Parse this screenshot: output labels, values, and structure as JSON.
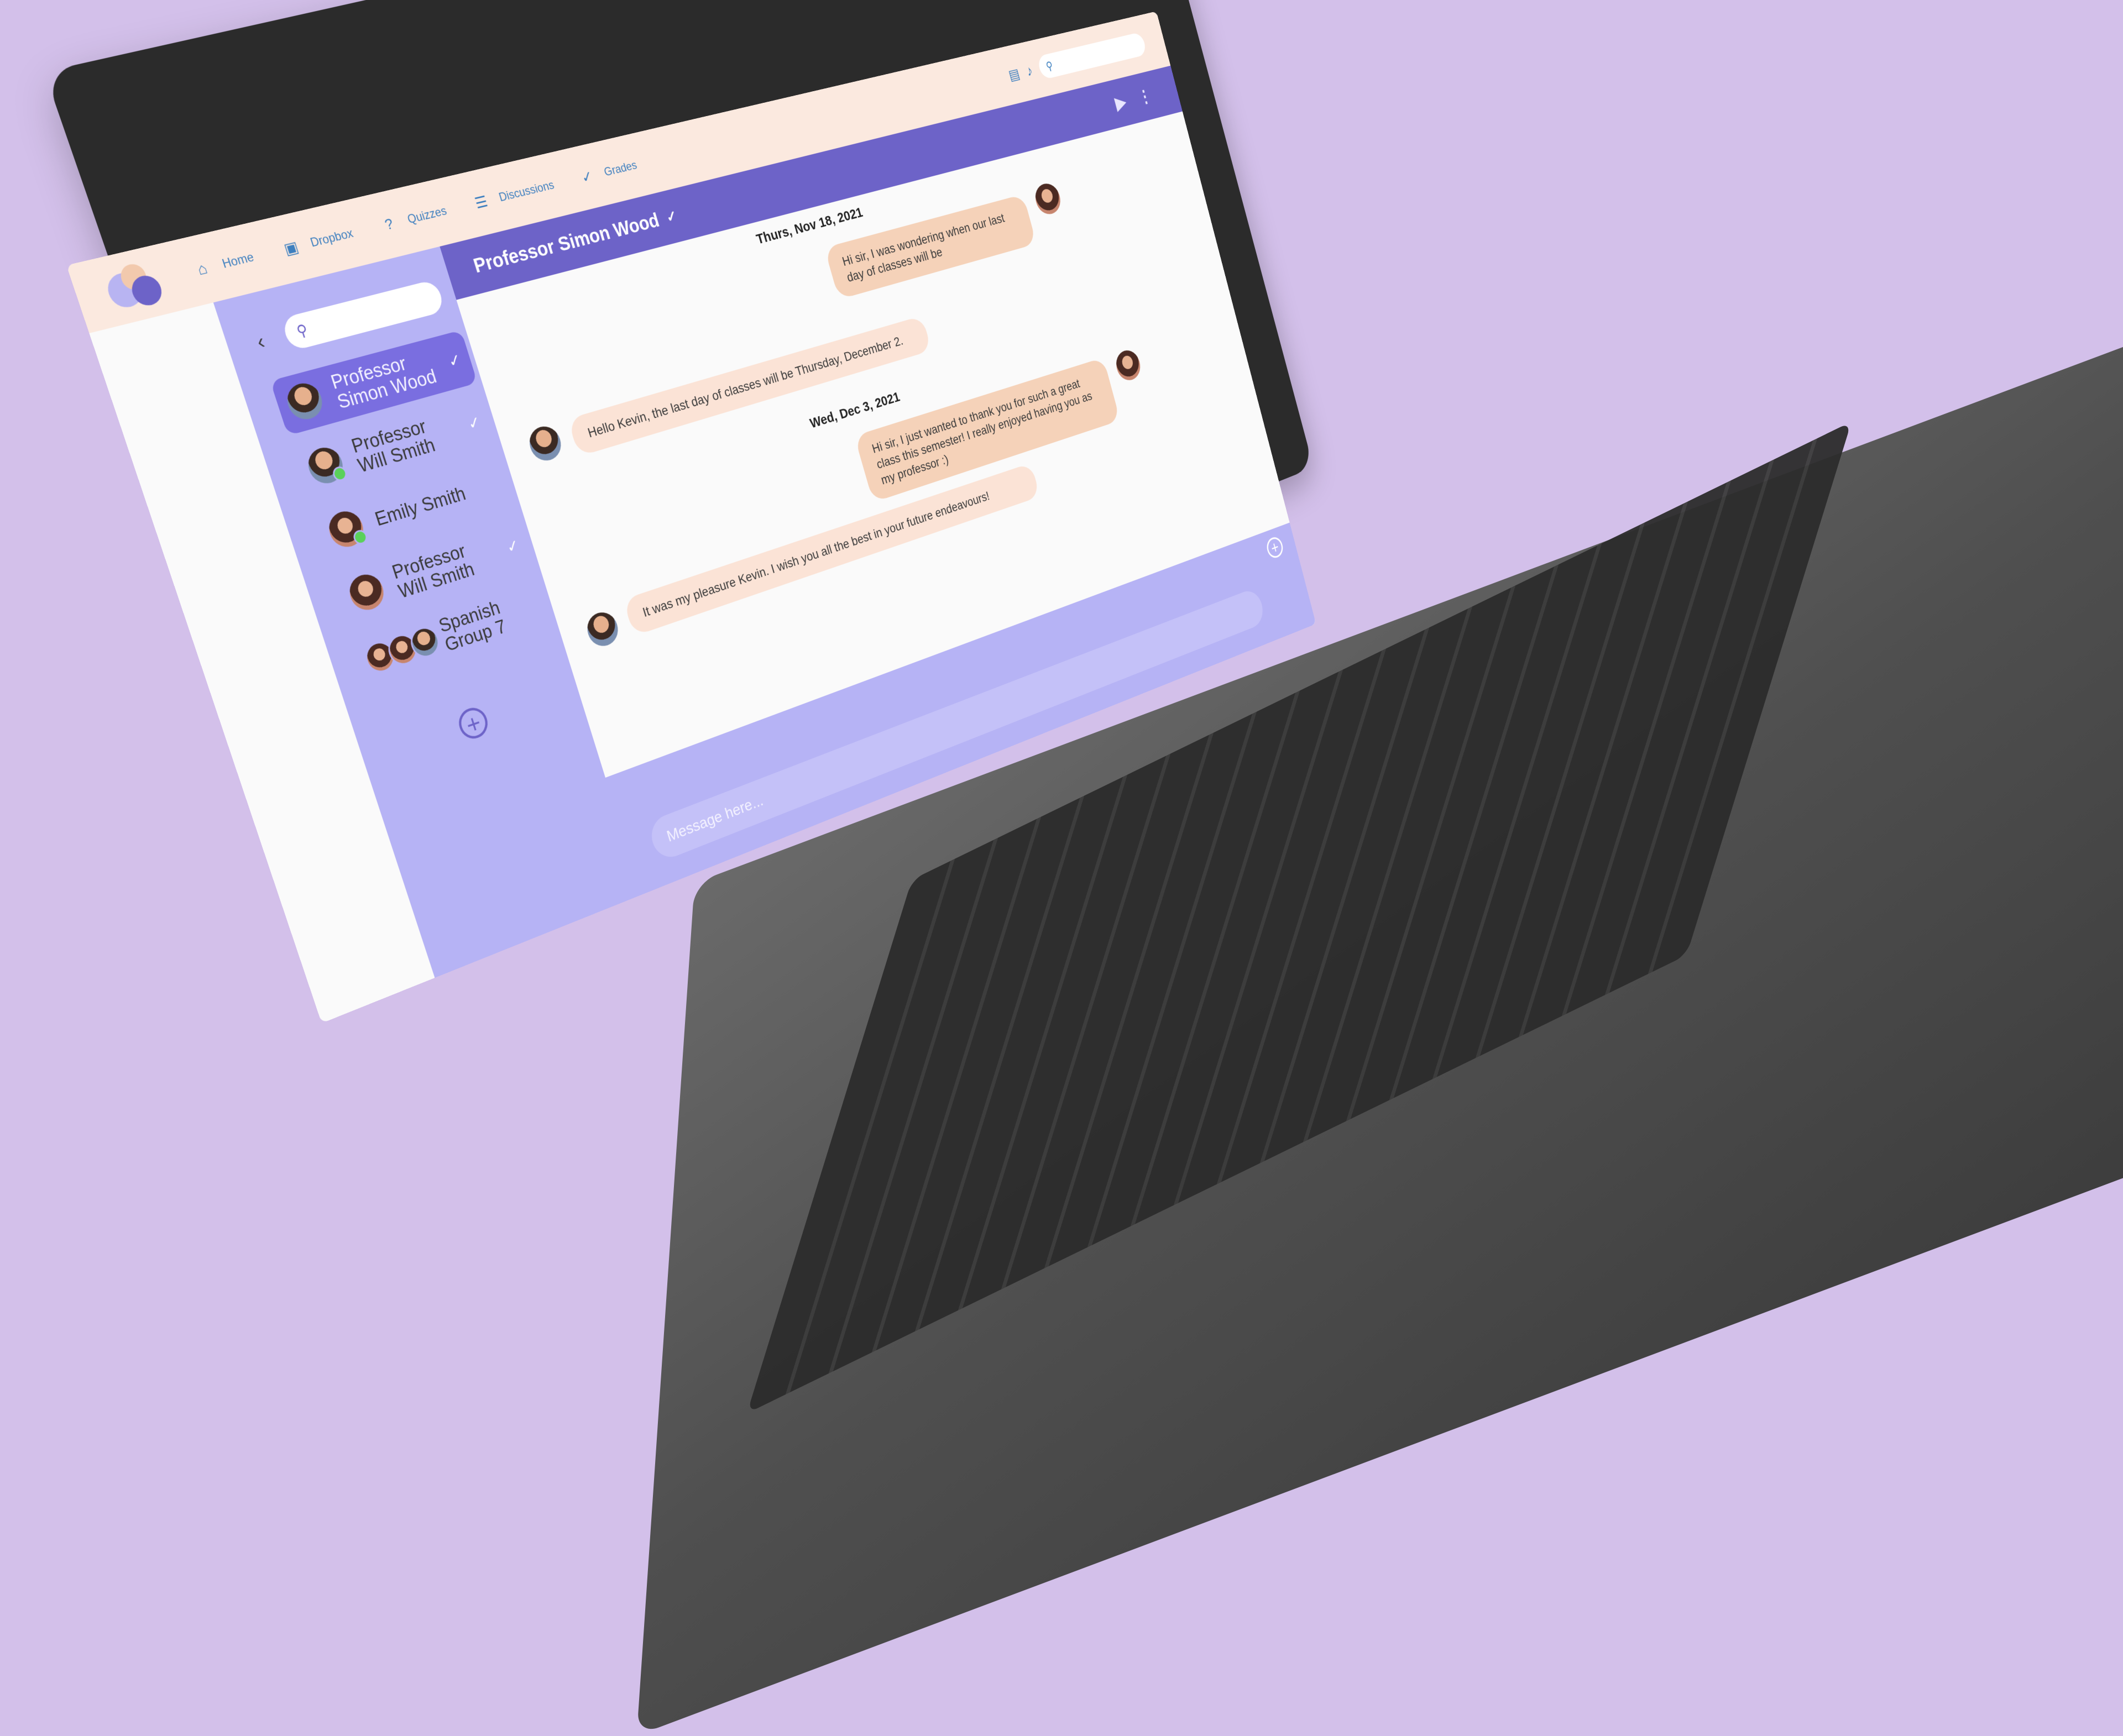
{
  "nav": {
    "items": [
      {
        "label": "Home",
        "icon": "home-icon"
      },
      {
        "label": "Dropbox",
        "icon": "inbox-icon"
      },
      {
        "label": "Quizzes",
        "icon": "question-icon"
      },
      {
        "label": "Discussions",
        "icon": "discussion-icon"
      },
      {
        "label": "Grades",
        "icon": "double-check-icon"
      }
    ],
    "right_icons": [
      "chat-icon",
      "bell-icon"
    ],
    "search_icon": "search-icon"
  },
  "sidebar": {
    "contacts": [
      {
        "line1": "Professor",
        "line2": "Simon Wood",
        "active": true,
        "read": true
      },
      {
        "line1": "Professor",
        "line2": "Will Smith",
        "online": true,
        "read": true
      },
      {
        "line1": "Emily Smith",
        "line2": "",
        "online": true
      },
      {
        "line1": "Professor",
        "line2": "Will Smith",
        "read": true
      },
      {
        "line1": "Spanish",
        "line2": "Group 7",
        "group": true
      }
    ]
  },
  "chat": {
    "title": "Professor Simon Wood",
    "header_icons": [
      "video-icon",
      "more-vertical-icon"
    ],
    "messages": [
      {
        "date": "Thurs, Nov 18, 2021"
      },
      {
        "from": "me",
        "text": "Hi sir, I was wondering when our last day of classes will be"
      },
      {
        "from": "them",
        "text": "Hello Kevin, the last day of classes will be Thursday, December 2."
      },
      {
        "date": "Wed, Dec 3, 2021"
      },
      {
        "from": "me",
        "text": "Hi sir, I just wanted to thank you for such a great class this semester! I really enjoyed having you as my professor :)"
      },
      {
        "from": "them",
        "text": "It was my pleasure Kevin. I wish you all the best in your future endeavours!"
      }
    ],
    "composer_placeholder": "Message here...",
    "colors": {
      "header": "#6d63c8",
      "sidebar": "#b6b3f5",
      "sent": "#f5d2b9",
      "received": "#fbe3d6",
      "nav": "#fbe9df",
      "background": "#d3c0ea"
    }
  }
}
